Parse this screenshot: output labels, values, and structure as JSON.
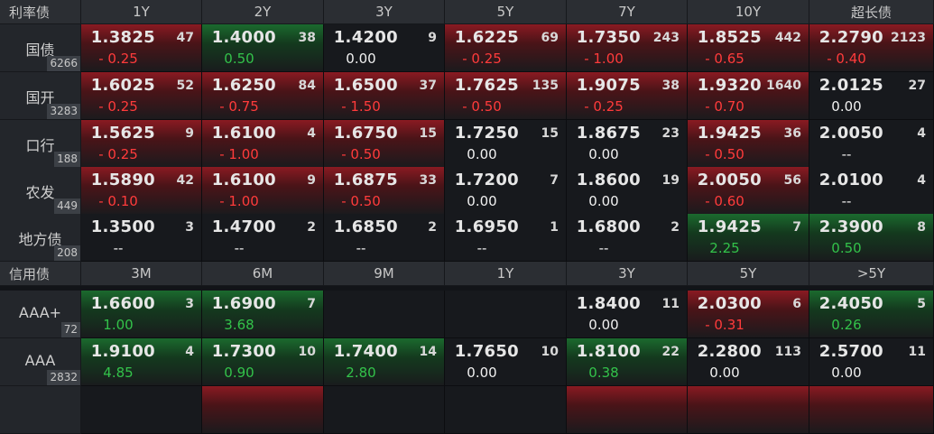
{
  "rate_section": {
    "title": "利率债",
    "columns": [
      "1Y",
      "2Y",
      "3Y",
      "5Y",
      "7Y",
      "10Y",
      "超长债"
    ],
    "rows": [
      {
        "name": "国债",
        "count": "6266",
        "cells": [
          {
            "price": "1.3825",
            "vol": "47",
            "chg": "- 0.25",
            "dir": "neg",
            "bg": "red"
          },
          {
            "price": "1.4000",
            "vol": "38",
            "chg": "0.50",
            "dir": "pos",
            "bg": "green"
          },
          {
            "price": "1.4200",
            "vol": "9",
            "chg": "0.00",
            "dir": "zero",
            "bg": "none"
          },
          {
            "price": "1.6225",
            "vol": "69",
            "chg": "- 0.25",
            "dir": "neg",
            "bg": "red"
          },
          {
            "price": "1.7350",
            "vol": "243",
            "chg": "- 1.00",
            "dir": "neg",
            "bg": "red"
          },
          {
            "price": "1.8525",
            "vol": "442",
            "chg": "- 0.65",
            "dir": "neg",
            "bg": "red"
          },
          {
            "price": "2.2790",
            "vol": "2123",
            "chg": "- 0.40",
            "dir": "neg",
            "bg": "red"
          }
        ]
      },
      {
        "name": "国开",
        "count": "3283",
        "cells": [
          {
            "price": "1.6025",
            "vol": "52",
            "chg": "- 0.25",
            "dir": "neg",
            "bg": "red"
          },
          {
            "price": "1.6250",
            "vol": "84",
            "chg": "- 0.75",
            "dir": "neg",
            "bg": "red"
          },
          {
            "price": "1.6500",
            "vol": "37",
            "chg": "- 1.50",
            "dir": "neg",
            "bg": "red"
          },
          {
            "price": "1.7625",
            "vol": "135",
            "chg": "- 0.50",
            "dir": "neg",
            "bg": "red"
          },
          {
            "price": "1.9075",
            "vol": "38",
            "chg": "- 0.25",
            "dir": "neg",
            "bg": "red"
          },
          {
            "price": "1.9320",
            "vol": "1640",
            "chg": "- 0.70",
            "dir": "neg",
            "bg": "red"
          },
          {
            "price": "2.0125",
            "vol": "27",
            "chg": "0.00",
            "dir": "zero",
            "bg": "none"
          }
        ]
      },
      {
        "name": "口行",
        "count": "188",
        "cells": [
          {
            "price": "1.5625",
            "vol": "9",
            "chg": "- 0.25",
            "dir": "neg",
            "bg": "red"
          },
          {
            "price": "1.6100",
            "vol": "4",
            "chg": "- 1.00",
            "dir": "neg",
            "bg": "red"
          },
          {
            "price": "1.6750",
            "vol": "15",
            "chg": "- 0.50",
            "dir": "neg",
            "bg": "red"
          },
          {
            "price": "1.7250",
            "vol": "15",
            "chg": "0.00",
            "dir": "zero",
            "bg": "none"
          },
          {
            "price": "1.8675",
            "vol": "23",
            "chg": "0.00",
            "dir": "zero",
            "bg": "none"
          },
          {
            "price": "1.9425",
            "vol": "36",
            "chg": "- 0.50",
            "dir": "neg",
            "bg": "red"
          },
          {
            "price": "2.0050",
            "vol": "4",
            "chg": "--",
            "dir": "dash",
            "bg": "none"
          }
        ]
      },
      {
        "name": "农发",
        "count": "449",
        "cells": [
          {
            "price": "1.5890",
            "vol": "42",
            "chg": "- 0.10",
            "dir": "neg",
            "bg": "red"
          },
          {
            "price": "1.6100",
            "vol": "9",
            "chg": "- 1.00",
            "dir": "neg",
            "bg": "red"
          },
          {
            "price": "1.6875",
            "vol": "33",
            "chg": "- 0.50",
            "dir": "neg",
            "bg": "red"
          },
          {
            "price": "1.7200",
            "vol": "7",
            "chg": "0.00",
            "dir": "zero",
            "bg": "none"
          },
          {
            "price": "1.8600",
            "vol": "19",
            "chg": "0.00",
            "dir": "zero",
            "bg": "none"
          },
          {
            "price": "2.0050",
            "vol": "56",
            "chg": "- 0.60",
            "dir": "neg",
            "bg": "red"
          },
          {
            "price": "2.0100",
            "vol": "4",
            "chg": "--",
            "dir": "dash",
            "bg": "none"
          }
        ]
      },
      {
        "name": "地方债",
        "count": "208",
        "cells": [
          {
            "price": "1.3500",
            "vol": "3",
            "chg": "--",
            "dir": "dash",
            "bg": "none"
          },
          {
            "price": "1.4700",
            "vol": "2",
            "chg": "--",
            "dir": "dash",
            "bg": "none"
          },
          {
            "price": "1.6850",
            "vol": "2",
            "chg": "--",
            "dir": "dash",
            "bg": "none"
          },
          {
            "price": "1.6950",
            "vol": "1",
            "chg": "--",
            "dir": "dash",
            "bg": "none"
          },
          {
            "price": "1.6800",
            "vol": "2",
            "chg": "--",
            "dir": "dash",
            "bg": "none"
          },
          {
            "price": "1.9425",
            "vol": "7",
            "chg": "2.25",
            "dir": "pos",
            "bg": "green"
          },
          {
            "price": "2.3900",
            "vol": "8",
            "chg": "0.50",
            "dir": "pos",
            "bg": "green"
          }
        ]
      }
    ]
  },
  "credit_section": {
    "title": "信用债",
    "columns": [
      "3M",
      "6M",
      "9M",
      "1Y",
      "3Y",
      "5Y",
      ">5Y"
    ],
    "rows": [
      {
        "name": "AAA+",
        "count": "72",
        "cells": [
          {
            "price": "1.6600",
            "vol": "3",
            "chg": "1.00",
            "dir": "pos",
            "bg": "green"
          },
          {
            "price": "1.6900",
            "vol": "7",
            "chg": "3.68",
            "dir": "pos",
            "bg": "green"
          },
          {
            "price": "",
            "vol": "",
            "chg": "",
            "dir": "zero",
            "bg": "empty"
          },
          {
            "price": "",
            "vol": "",
            "chg": "",
            "dir": "zero",
            "bg": "empty"
          },
          {
            "price": "1.8400",
            "vol": "11",
            "chg": "0.00",
            "dir": "zero",
            "bg": "none"
          },
          {
            "price": "2.0300",
            "vol": "6",
            "chg": "- 0.31",
            "dir": "neg",
            "bg": "red"
          },
          {
            "price": "2.4050",
            "vol": "5",
            "chg": "0.26",
            "dir": "pos",
            "bg": "green"
          }
        ]
      },
      {
        "name": "AAA",
        "count": "2832",
        "cells": [
          {
            "price": "1.9100",
            "vol": "4",
            "chg": "4.85",
            "dir": "pos",
            "bg": "green"
          },
          {
            "price": "1.7300",
            "vol": "10",
            "chg": "0.90",
            "dir": "pos",
            "bg": "green"
          },
          {
            "price": "1.7400",
            "vol": "14",
            "chg": "2.80",
            "dir": "pos",
            "bg": "green"
          },
          {
            "price": "1.7650",
            "vol": "10",
            "chg": "0.00",
            "dir": "zero",
            "bg": "none"
          },
          {
            "price": "1.8100",
            "vol": "22",
            "chg": "0.38",
            "dir": "pos",
            "bg": "green"
          },
          {
            "price": "2.2800",
            "vol": "113",
            "chg": "0.00",
            "dir": "zero",
            "bg": "none"
          },
          {
            "price": "2.5700",
            "vol": "11",
            "chg": "0.00",
            "dir": "zero",
            "bg": "none"
          }
        ]
      },
      {
        "name": "",
        "count": "",
        "cells": [
          {
            "price": "",
            "vol": "",
            "chg": "",
            "dir": "zero",
            "bg": "none"
          },
          {
            "price": "",
            "vol": "",
            "chg": "",
            "dir": "zero",
            "bg": "red"
          },
          {
            "price": "",
            "vol": "",
            "chg": "",
            "dir": "zero",
            "bg": "none"
          },
          {
            "price": "",
            "vol": "",
            "chg": "",
            "dir": "zero",
            "bg": "none"
          },
          {
            "price": "",
            "vol": "",
            "chg": "",
            "dir": "zero",
            "bg": "red"
          },
          {
            "price": "",
            "vol": "",
            "chg": "",
            "dir": "zero",
            "bg": "red"
          },
          {
            "price": "",
            "vol": "",
            "chg": "",
            "dir": "zero",
            "bg": "red"
          }
        ]
      }
    ]
  },
  "colors": {
    "up": "#ff3b3b",
    "down": "#33c24a",
    "header_bg": "#2b2e33",
    "label_bg": "#23262b"
  }
}
